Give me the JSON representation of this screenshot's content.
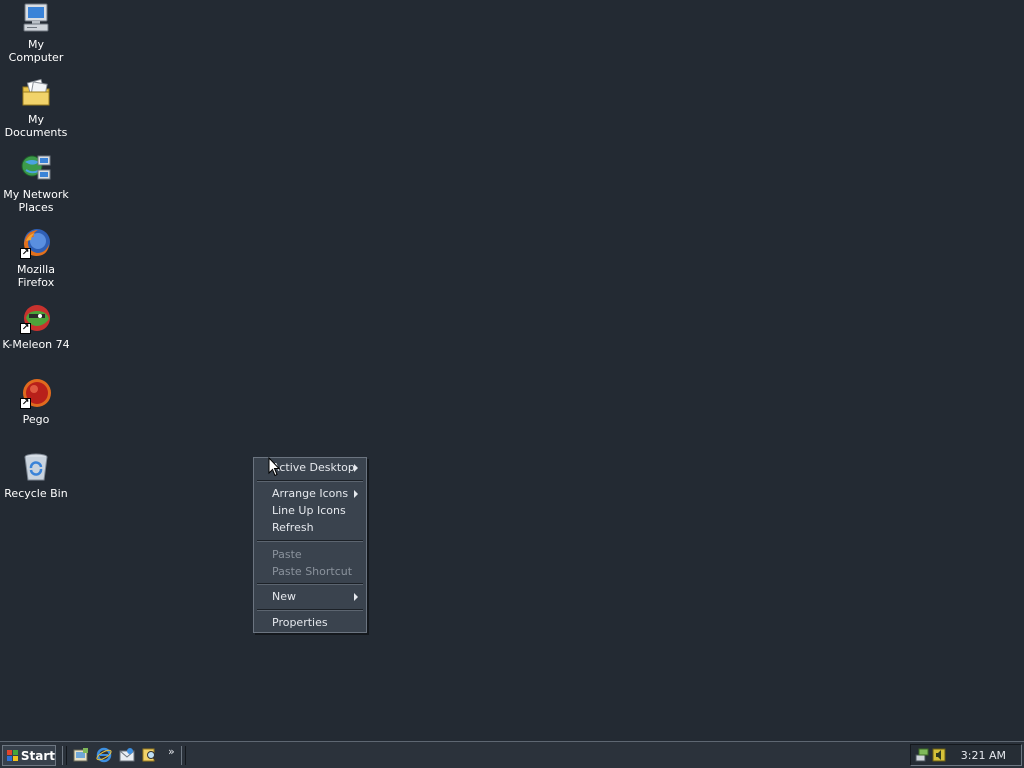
{
  "desktop": {
    "icons": [
      {
        "label": "My Computer",
        "icon": "my-computer-icon"
      },
      {
        "label": "My Documents",
        "icon": "my-documents-icon"
      },
      {
        "label": "My Network Places",
        "icon": "network-places-icon"
      },
      {
        "label": "Mozilla Firefox",
        "icon": "firefox-icon"
      },
      {
        "label": "K-Meleon 74",
        "icon": "k-meleon-icon"
      },
      {
        "label": "Pego",
        "icon": "pego-icon"
      },
      {
        "label": "Recycle Bin",
        "icon": "recycle-bin-icon"
      }
    ]
  },
  "context_menu": {
    "items": [
      {
        "label": "Active Desktop",
        "submenu": true,
        "enabled": true
      },
      {
        "label": "Arrange Icons",
        "submenu": true,
        "enabled": true
      },
      {
        "label": "Line Up Icons",
        "submenu": false,
        "enabled": true
      },
      {
        "label": "Refresh",
        "submenu": false,
        "enabled": true
      },
      {
        "label": "Paste",
        "submenu": false,
        "enabled": false
      },
      {
        "label": "Paste Shortcut",
        "submenu": false,
        "enabled": false
      },
      {
        "label": "New",
        "submenu": true,
        "enabled": true
      },
      {
        "label": "Properties",
        "submenu": false,
        "enabled": true
      }
    ]
  },
  "taskbar": {
    "start_label": "Start",
    "quick_launch": [
      "show-desktop-icon",
      "internet-explorer-icon",
      "outlook-express-icon",
      "search-icon"
    ],
    "more_label": "»",
    "clock": "3:21 AM"
  },
  "colors": {
    "desktop_bg": "#232a33",
    "menu_bg": "#3a434e",
    "taskbar_bg": "#2b323b"
  }
}
